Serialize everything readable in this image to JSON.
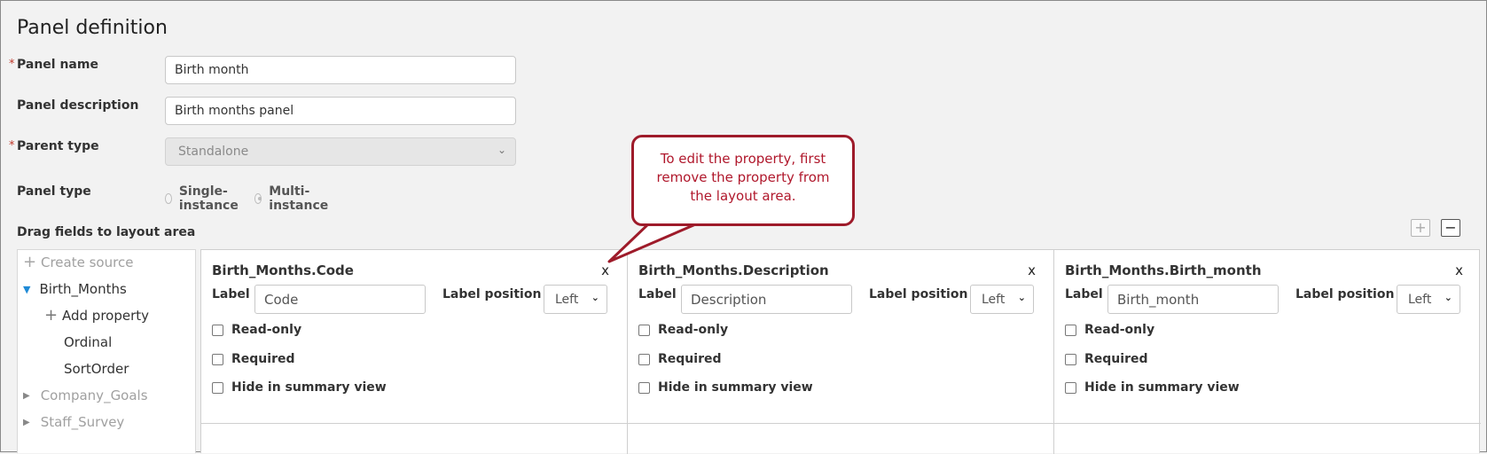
{
  "page": {
    "title": "Panel definition",
    "required_mark": "*"
  },
  "form": {
    "panel_name": {
      "label": "Panel name",
      "value": "Birth month"
    },
    "panel_description": {
      "label": "Panel description",
      "value": "Birth months panel"
    },
    "parent_type": {
      "label": "Parent type",
      "value": "Standalone"
    },
    "panel_type": {
      "label": "Panel type",
      "options": [
        "Single-instance",
        "Multi-instance"
      ],
      "selected": "Multi-instance"
    }
  },
  "layout_section": {
    "label": "Drag fields to layout area",
    "add_symbol": "+",
    "remove_symbol": "−"
  },
  "tree": {
    "create_source": "Create source",
    "source": "Birth_Months",
    "add_property": "Add property",
    "properties": [
      "Ordinal",
      "SortOrder"
    ],
    "other_sources": [
      "Company_Goals",
      "Staff_Survey"
    ]
  },
  "cards": [
    {
      "title": "Birth_Months.Code",
      "label_text": "Label",
      "label_value": "Code",
      "position_label": "Label position",
      "position_value": "Left"
    },
    {
      "title": "Birth_Months.Description",
      "label_text": "Label",
      "label_value": "Description",
      "position_label": "Label position",
      "position_value": "Left"
    },
    {
      "title": "Birth_Months.Birth_month",
      "label_text": "Label",
      "label_value": "Birth_month",
      "position_label": "Label position",
      "position_value": "Left"
    }
  ],
  "card_common": {
    "close": "x",
    "checkboxes": [
      "Read-only",
      "Required",
      "Hide in summary view"
    ]
  },
  "callout": {
    "text": "To edit the property, first remove the property from the layout area.",
    "color": "#9e1b2a"
  }
}
